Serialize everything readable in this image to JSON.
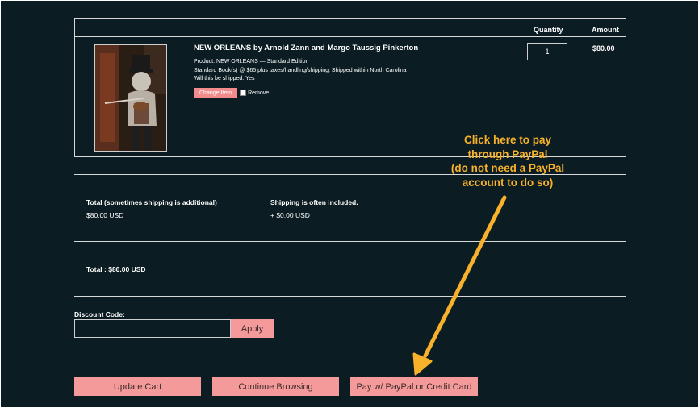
{
  "cart": {
    "headers": {
      "quantity": "Quantity",
      "amount": "Amount"
    },
    "item": {
      "title": "NEW ORLEANS by Arnold Zann and Margo Taussig Pinkerton",
      "product_line": "Product: NEW ORLEANS — Standard Edition",
      "price_line": "Standard Book(s) @ $65 plus taxes/handling/shipping: Shipped within North Carolina",
      "shipped_line": "Will this be shipped: Yes",
      "change_label": "Change Item",
      "remove_label": "Remove",
      "quantity": "1",
      "amount": "$80.00"
    }
  },
  "totals": {
    "total_label": "Total (sometimes shipping is additional)",
    "total_value": "$80.00 USD",
    "shipping_label": "Shipping is often included.",
    "shipping_value": "+ $0.00 USD",
    "grand_total": "Total : $80.00 USD"
  },
  "discount": {
    "label": "Discount Code:",
    "value": "",
    "apply_label": "Apply"
  },
  "buttons": {
    "update": "Update Cart",
    "continue": "Continue Browsing",
    "pay": "Pay w/ PayPal or Credit Card"
  },
  "annotation": {
    "line1": "Click here to pay",
    "line2": "through PayPal",
    "line3": "(do not need a PayPal",
    "line4": "account to do so)"
  },
  "colors": {
    "background": "#0b1c22",
    "button": "#f59a9a",
    "annotation": "#f7b12a"
  }
}
